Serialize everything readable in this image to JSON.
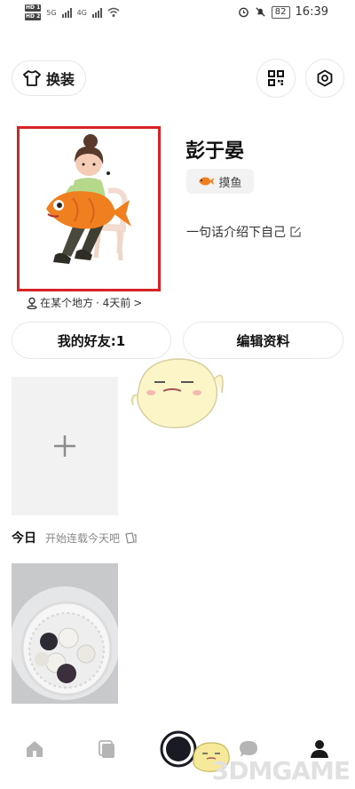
{
  "status_bar": {
    "sim1": "HD 1",
    "sim2": "HD 2",
    "network1": "5G",
    "network2": "4G",
    "battery": "82",
    "time": "16:39"
  },
  "header": {
    "outfit_label": "换装"
  },
  "profile": {
    "username": "彭于晏",
    "tag_label": "摸鱼",
    "bio_prompt": "一句话介绍下自己",
    "location": "在某个地方",
    "location_time": "· 4天前",
    "location_arrow": ">"
  },
  "actions": {
    "friends_label": "我的好友:1",
    "edit_label": "编辑资料"
  },
  "feed": {
    "today_label": "今日",
    "today_hint": "开始连载今天吧"
  },
  "watermark": "3DMGAME",
  "icons": {
    "outfit": "tshirt-icon",
    "qr": "qr-code-icon",
    "settings": "gear-icon",
    "tag": "fish-icon",
    "edit": "edit-icon",
    "location": "location-pin-icon",
    "add": "plus-icon",
    "nav": [
      "home-icon",
      "cards-icon",
      "camera-shutter-icon",
      "chat-bubble-icon",
      "profile-icon"
    ]
  },
  "colors": {
    "highlight_border": "#d72323",
    "fish_orange": "#f07f1f"
  }
}
